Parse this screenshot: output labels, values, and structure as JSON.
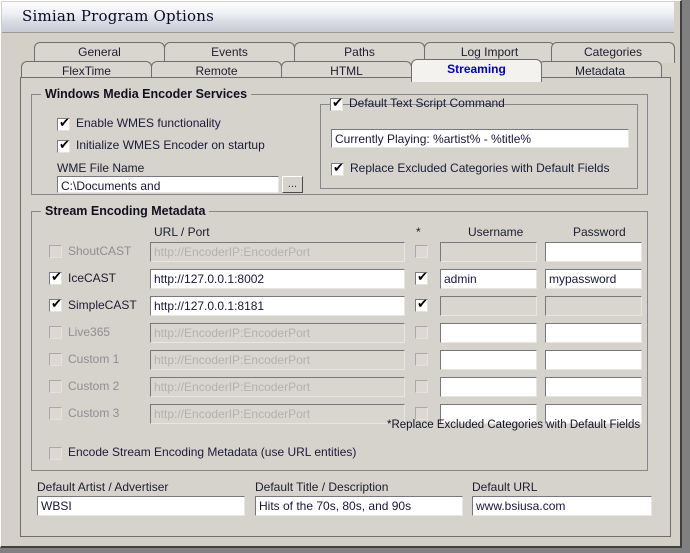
{
  "window": {
    "title": "Simian Program Options"
  },
  "tabs_row1": [
    {
      "label": "General",
      "active": false
    },
    {
      "label": "Events",
      "active": false
    },
    {
      "label": "Paths",
      "active": false
    },
    {
      "label": "Log Import",
      "active": false
    },
    {
      "label": "Categories",
      "active": false
    }
  ],
  "tabs_row2": [
    {
      "label": "FlexTime",
      "active": false
    },
    {
      "label": "Remote",
      "active": false
    },
    {
      "label": "HTML",
      "active": false
    },
    {
      "label": "Streaming",
      "active": true
    },
    {
      "label": "Metadata",
      "active": false
    }
  ],
  "wmes": {
    "group_title": "Windows Media Encoder Services",
    "enable_label": "Enable WMES functionality",
    "enable_checked": true,
    "init_label": "Initialize WMES Encoder on startup",
    "init_checked": true,
    "file_name_label": "WME File Name",
    "file_name_value": "C:\\Documents and",
    "browse_label": "..."
  },
  "script_cmd": {
    "group_title": "Default Text Script Command",
    "group_checked": true,
    "value": "Currently Playing: %artist% - %title%",
    "replace_label": "Replace Excluded Categories with Default Fields",
    "replace_checked": true
  },
  "stream": {
    "group_title": "Stream Encoding Metadata",
    "col_url": "URL / Port",
    "col_star": "*",
    "col_username": "Username",
    "col_password": "Password",
    "url_placeholder": "http://EncoderIP:EncoderPort",
    "rows": [
      {
        "name": "ShoutCAST",
        "enabled": false,
        "checked": false,
        "url": "",
        "url_placeholder": true,
        "star": false,
        "username": "",
        "password": "",
        "user_disabled": true,
        "pass_disabled": false
      },
      {
        "name": "IceCAST",
        "enabled": true,
        "checked": true,
        "url": "http://127.0.0.1:8002",
        "url_placeholder": false,
        "star": true,
        "username": "admin",
        "password": "mypassword",
        "user_disabled": false,
        "pass_disabled": false
      },
      {
        "name": "SimpleCAST",
        "enabled": true,
        "checked": true,
        "url": "http://127.0.0.1:8181",
        "url_placeholder": false,
        "star": true,
        "username": "",
        "password": "",
        "user_disabled": true,
        "pass_disabled": true
      },
      {
        "name": "Live365",
        "enabled": false,
        "checked": false,
        "url": "",
        "url_placeholder": true,
        "star": false,
        "username": "",
        "password": "",
        "user_disabled": false,
        "pass_disabled": false
      },
      {
        "name": "Custom 1",
        "enabled": false,
        "checked": false,
        "url": "",
        "url_placeholder": true,
        "star": false,
        "username": "",
        "password": "",
        "user_disabled": false,
        "pass_disabled": false
      },
      {
        "name": "Custom 2",
        "enabled": false,
        "checked": false,
        "url": "",
        "url_placeholder": true,
        "star": false,
        "username": "",
        "password": "",
        "user_disabled": false,
        "pass_disabled": false
      },
      {
        "name": "Custom 3",
        "enabled": false,
        "checked": false,
        "url": "",
        "url_placeholder": true,
        "star": false,
        "username": "",
        "password": "",
        "user_disabled": false,
        "pass_disabled": false
      }
    ],
    "footnote": "*Replace Excluded Categories with Default Fields",
    "encode_label": "Encode Stream Encoding Metadata (use URL entities)",
    "encode_checked": false
  },
  "defaults": {
    "artist_label": "Default Artist / Advertiser",
    "artist_value": "WBSI",
    "title_label": "Default Title / Description",
    "title_value": "Hits of the 70s, 80s, and 90s",
    "url_label": "Default URL",
    "url_value": "www.bsiusa.com"
  }
}
